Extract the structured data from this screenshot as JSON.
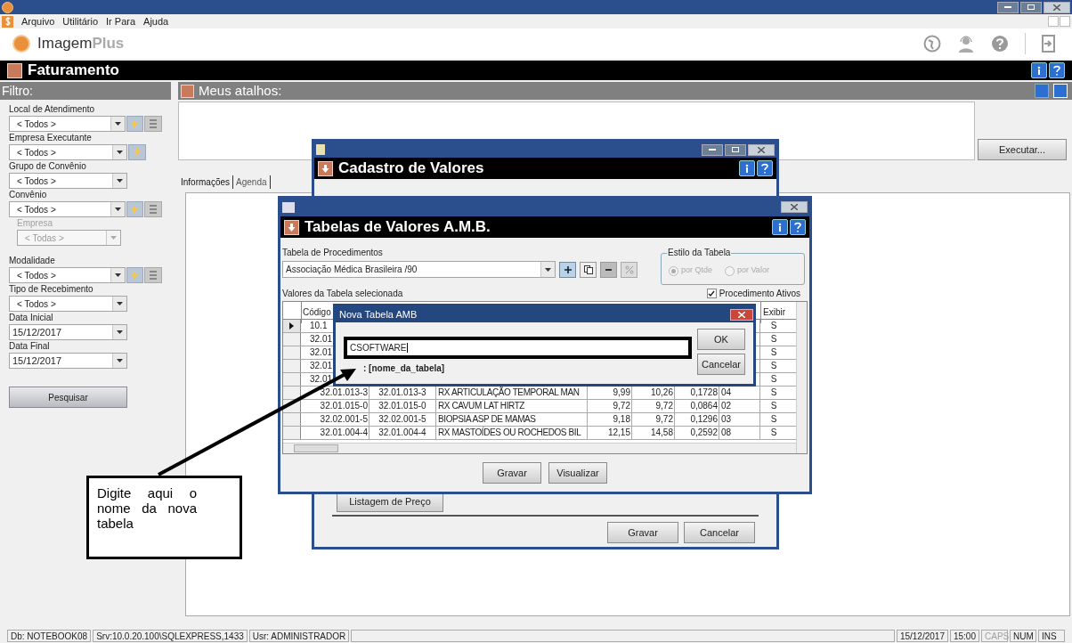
{
  "menu": [
    "Arquivo",
    "Utilitário",
    "Ir Para",
    "Ajuda"
  ],
  "logo": {
    "name": "Imagem",
    "suffix": "Plus"
  },
  "module_title": "Faturamento",
  "filter": {
    "title": "Filtro:",
    "fields": [
      {
        "label": "Local de Atendimento",
        "value": "< Todos >",
        "kind": "combo-full",
        "disabled": false
      },
      {
        "label": "Empresa Executante",
        "value": "< Todos >",
        "kind": "combo-bolt",
        "disabled": false
      },
      {
        "label": "Grupo de Convênio",
        "value": "< Todos >",
        "kind": "combo",
        "disabled": false
      },
      {
        "label": "Convênio",
        "value": "< Todos >",
        "kind": "combo-full",
        "disabled": false
      },
      {
        "label": "Empresa",
        "value": "< Todas >",
        "kind": "sub-combo",
        "disabled": true
      },
      {
        "label": "Modalidade",
        "value": "< Todos >",
        "kind": "combo-full",
        "disabled": false
      },
      {
        "label": "Tipo de Recebimento",
        "value": "< Todos >",
        "kind": "combo",
        "disabled": false
      },
      {
        "label": "Data Inicial",
        "value": "15/12/2017",
        "kind": "date",
        "disabled": false
      },
      {
        "label": "Data Final",
        "value": "15/12/2017",
        "kind": "date",
        "disabled": false
      }
    ],
    "search_button": "Pesquisar"
  },
  "shortcuts": {
    "title": "Meus atalhos:",
    "run_button": "Executar..."
  },
  "tabs": [
    {
      "label": "Informações",
      "selected": true
    },
    {
      "label": "Agenda",
      "selected": false
    }
  ],
  "cadastro_window": {
    "title": "Cadastro de Valores",
    "price_list_button": "Listagem de Preço",
    "buttons": [
      "Gravar",
      "Cancelar"
    ]
  },
  "tabelas_window": {
    "title": "Tabelas de Valores A.M.B.",
    "procedure_table": {
      "label": "Tabela de Procedimentos",
      "value": "Associação Médica Brasileira /90"
    },
    "style_group": {
      "title": "Estilo da Tabela",
      "disabled": true,
      "options": [
        {
          "label": "por Qtde",
          "selected": true
        },
        {
          "label": "por Valor",
          "selected": false
        }
      ]
    },
    "grid_label": "Valores da Tabela selecionada",
    "active_filter": {
      "label": "Procedimento Ativos",
      "checked": true
    },
    "columns": {
      "code": "Código",
      "exibir": "Exibir"
    },
    "rows": [
      {
        "current": true,
        "code": "10.1",
        "exibir": "S"
      },
      {
        "current": false,
        "code": "32.01",
        "exibir": "S"
      },
      {
        "current": false,
        "code": "32.01",
        "exibir": "S"
      },
      {
        "current": false,
        "code": "32.01",
        "exibir": "S"
      },
      {
        "current": false,
        "code": "32.01",
        "exibir": "S"
      },
      {
        "current": false,
        "code": "32.01.013-3",
        "code_2": "32.01.013-3",
        "description": "RX ARTICULAÇÃO TEMPORAL MAN",
        "value_1": "9,99",
        "value_2": "10,26",
        "value_3": "0,1728",
        "column_7": "04",
        "exibir": "S"
      },
      {
        "current": false,
        "code": "32.01.015-0",
        "code_2": "32.01.015-0",
        "description": "RX CAVUM LAT HIRTZ",
        "value_1": "9,72",
        "value_2": "9,72",
        "value_3": "0,0864",
        "column_7": "02",
        "exibir": "S"
      },
      {
        "current": false,
        "code": "32.02.001-5",
        "code_2": "32.02.001-5",
        "description": "BIOPSIA  ASP DE MAMAS",
        "value_1": "9,18",
        "value_2": "9,72",
        "value_3": "0,1296",
        "column_7": "03",
        "exibir": "S"
      },
      {
        "current": false,
        "code": "32.01.004-4",
        "code_2": "32.01.004-4",
        "description": "RX MASTOÍDES OU ROCHEDOS BIL",
        "value_1": "12,15",
        "value_2": "14,58",
        "value_3": "0,2592",
        "column_7": "08",
        "exibir": "S"
      }
    ],
    "buttons": [
      "Gravar",
      "Visualizar"
    ]
  },
  "nova_tabela_dialog": {
    "title": "Nova Tabela AMB",
    "value": "CSOFTWARE",
    "hint": ": [nome_da_tabela]",
    "buttons": [
      "OK",
      "Cancelar"
    ]
  },
  "callout": {
    "text": "Digite aqui o nome da nova tabela"
  },
  "status_bar": [
    {
      "text": "Db: NOTEBOOK08",
      "kind": "info",
      "on": true
    },
    {
      "text": "Srv:10.0.20.100\\SQLEXPRESS,1433",
      "kind": "info",
      "on": true
    },
    {
      "text": "Usr: ADMINISTRADOR",
      "kind": "info",
      "on": true
    },
    {
      "kind": "spacer"
    },
    {
      "text": "15/12/2017",
      "kind": "info",
      "on": true
    },
    {
      "text": "15:00",
      "kind": "info",
      "on": true
    },
    {
      "text": "CAPS",
      "kind": "key",
      "on": false
    },
    {
      "text": "NUM",
      "kind": "key",
      "on": true
    },
    {
      "text": "INS",
      "kind": "key",
      "on": true
    }
  ]
}
